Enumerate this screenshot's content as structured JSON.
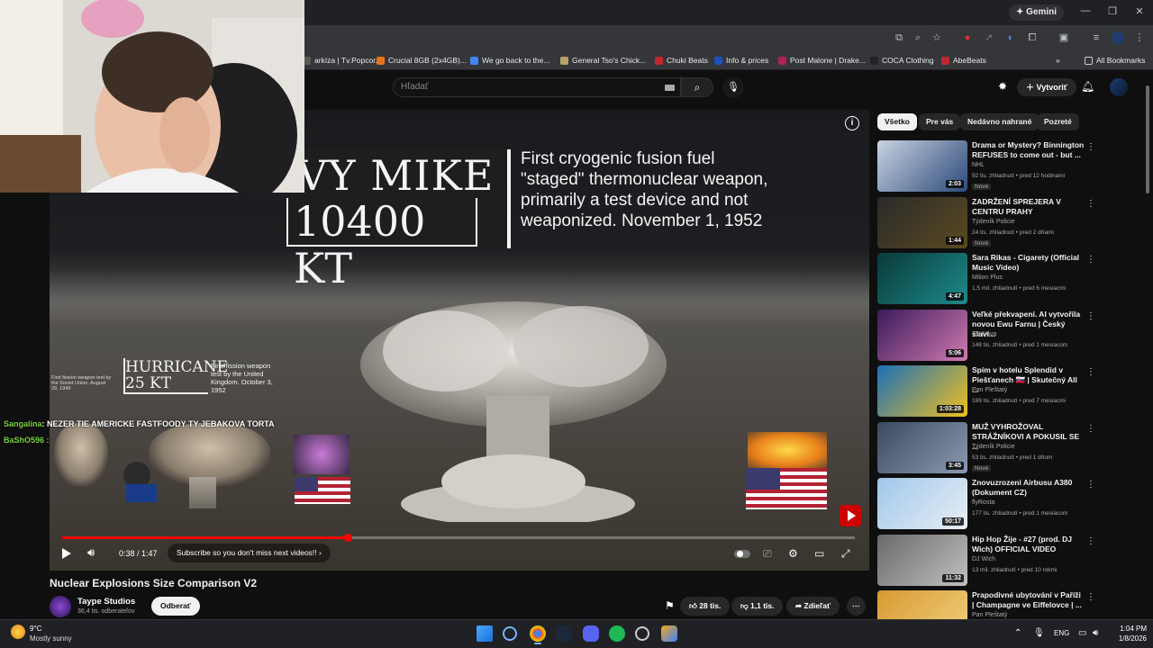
{
  "browser": {
    "gemini_label": "Gemini",
    "bookmarks": [
      {
        "label": "arkíza | Tv.Popcor...",
        "color": "#5a5a5a"
      },
      {
        "label": "Crucial 8GB (2x4GB)...",
        "color": "#e8711a"
      },
      {
        "label": "We go back to the...",
        "color": "#4285f4"
      },
      {
        "label": "General Tso's Chick...",
        "color": "#b7a06a"
      },
      {
        "label": "Chuki Beats",
        "color": "#c0282d"
      },
      {
        "label": "Info & prices",
        "color": "#1f4fbf"
      },
      {
        "label": "Post Malone | Drake...",
        "color": "#b0205a"
      },
      {
        "label": "COCA Clothing",
        "color": "#222222"
      },
      {
        "label": "AbeBeats",
        "color": "#c0282d"
      }
    ],
    "all_bookmarks": "All Bookmarks"
  },
  "youtube": {
    "search_placeholder": "Hľadať",
    "create_label": "Vytvoriť"
  },
  "video": {
    "overlay": {
      "ivy_name": "VY MIKE",
      "ivy_yield": "10400 KT",
      "ivy_desc": "First cryogenic fusion fuel \"staged\" thermonuclear weapon, primarily a test device and not weaponized. November 1, 1952",
      "small_note": "First fission weapon test by the Soviet Union. August 29, 1949",
      "hurricane_name": "HURRICANE",
      "hurricane_yield": "25 KT",
      "hurricane_desc": "First fission weapon test by the United Kingdom. October 3, 1952"
    },
    "chat": {
      "line1_user": "Sangalina",
      "line1_text": ": NEZER TIE AMERICKE FASTFOODY TY JEBAKOVA TORTA",
      "line2_user": "BaShO596",
      "line2_text": " : "
    },
    "progress": 0.36,
    "time": "0:38 / 1:47",
    "subscribe_prompt": "Subscribe so you don't miss next videos!!",
    "title": "Nuclear Explosions Size Comparison V2",
    "channel": "Taype Studios",
    "subscribers": "36,4 tis. odberateľov",
    "subscribe_button": "Odberať",
    "likes": "28 tis.",
    "dislikes": "1,1 tis.",
    "share": "Zdieľať"
  },
  "chips": [
    "Všetko",
    "Pre vás",
    "Nedávno nahrané",
    "Pozreté"
  ],
  "recommendations": [
    {
      "title": "Drama or Mystery? Binnington REFUSES to come out - but ...",
      "channel": "NHL",
      "meta": "92 tis. zhliadnutí • pred 12 hodinami",
      "new": "Nové",
      "duration": "2:03",
      "color1": "#c9d3e2",
      "color2": "#2c4a7a"
    },
    {
      "title": "ZADRŽENÍ SPREJERA V CENTRU PRAHY",
      "channel": "Týdeník Policie",
      "meta": "24 tis. zhliadnutí • pred 2 dňami",
      "new": "Nové",
      "duration": "1:44",
      "color1": "#2a2a2a",
      "color2": "#5a4a20"
    },
    {
      "title": "Sara Rikas - Cigarety (Official Music Video)",
      "channel": "Milion Plus",
      "meta": "1,5 mil. zhliadnutí • pred 6 mesiacmi",
      "new": "",
      "duration": "4:47",
      "color1": "#0a3a3a",
      "color2": "#1d8a8a"
    },
    {
      "title": "Veľké překvapení. AI vytvořila novou Ewu Farnu | Český slaví...",
      "channel": "TV Nova",
      "meta": "148 tis. zhliadnutí • pred 1 mesiacom",
      "new": "",
      "duration": "5:06",
      "color1": "#3a1a5a",
      "color2": "#d07ab0"
    },
    {
      "title": "Spím v hotelu Splendid v Piešťanech 🇸🇰 | Skutečný All ...",
      "channel": "Pan Pleštatý",
      "meta": "169 tis. zhliadnutí • pred 7 mesiacmi",
      "new": "",
      "duration": "1:03:28",
      "color1": "#1b6fb8",
      "color2": "#f0c020"
    },
    {
      "title": "MUŽ VYHROŽOVAL STRÁŽNÍKOVI A POKUSIL SE ...",
      "channel": "Týdeník Policie",
      "meta": "53 tis. zhliadnutí • pred 1 dňom",
      "new": "Nové",
      "duration": "3:45",
      "color1": "#3a4a60",
      "color2": "#8a9ab0"
    },
    {
      "title": "Znovuzrození Airbusu A380 (Dokument CZ)",
      "channel": "flyRosta",
      "meta": "177 tis. zhliadnutí • pred 1 mesiacom",
      "new": "",
      "duration": "50:17",
      "color1": "#9fc8ea",
      "color2": "#e8eef4"
    },
    {
      "title": "Hip Hop Žije - #27 (prod. DJ Wich) OFFICIAL VIDEO",
      "channel": "DJ Wich",
      "meta": "13 mil. zhliadnutí • pred 10 rokmi",
      "new": "",
      "duration": "11:32",
      "color1": "#6a6a6a",
      "color2": "#c0c0c0"
    },
    {
      "title": "Prapodivné ubytování v Paříži | Champagne ve Eiffelovce | ...",
      "channel": "Pan Pleštatý",
      "meta": "",
      "new": "",
      "duration": "",
      "color1": "#d89a30",
      "color2": "#f0d080"
    }
  ],
  "taskbar": {
    "temp": "9°C",
    "condition": "Mostly sunny",
    "lang": "ENG",
    "time": "1:04 PM",
    "date": "1/8/2026"
  }
}
